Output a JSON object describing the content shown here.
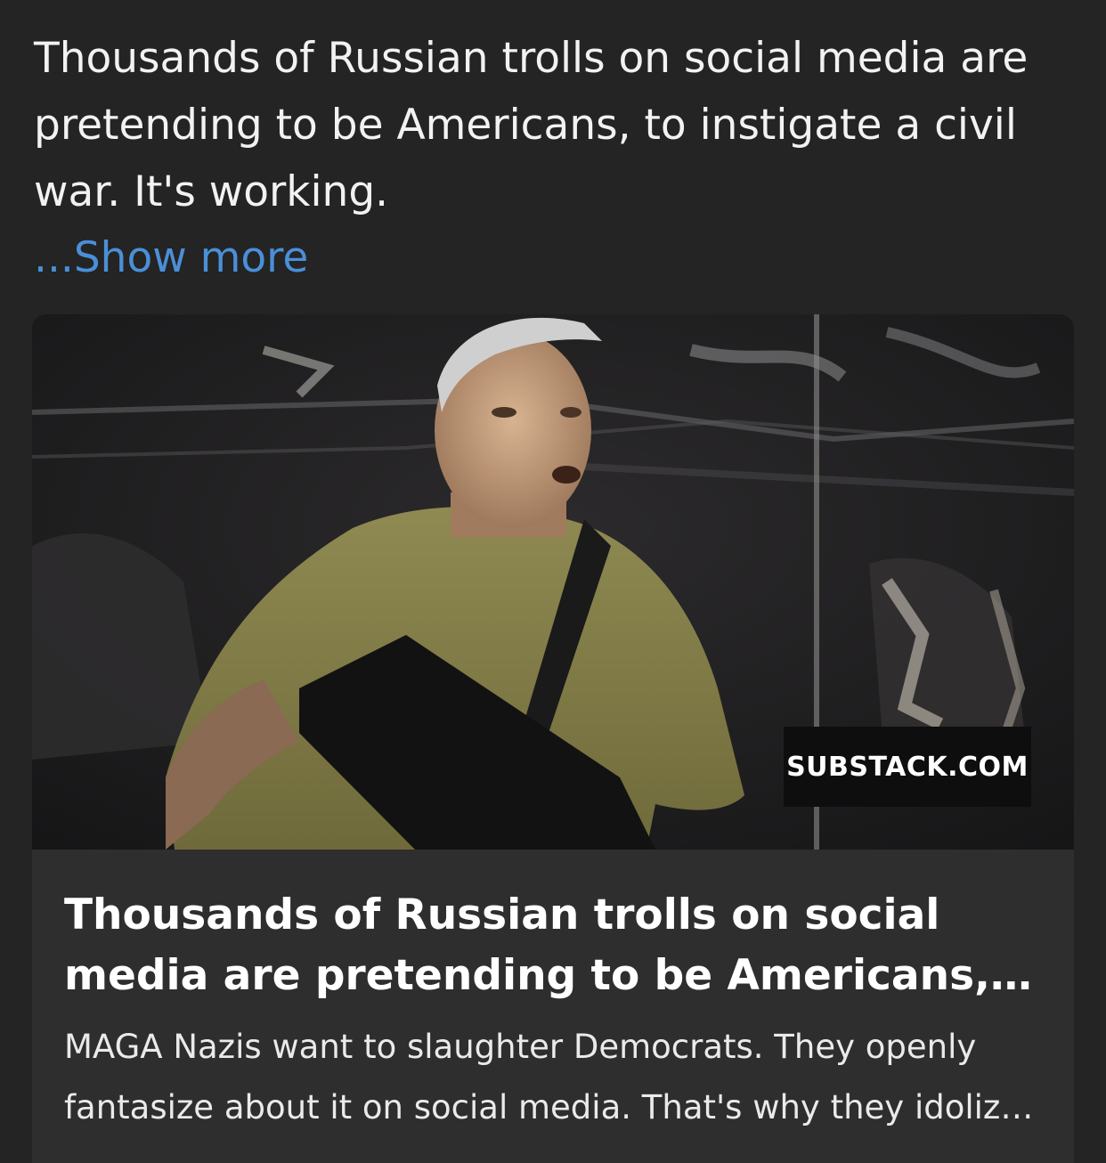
{
  "post": {
    "text": "Thousands of Russian trolls on social media are pretending to be Americans, to instigate a civil war. It's working.",
    "show_more": "...Show more"
  },
  "link_card": {
    "image_icon": "news-photo",
    "domain": "SUBSTACK.COM",
    "title": "Thousands of Russian trolls on social media are pretending to be Americans, to instigate a civil war. It's working.",
    "description": "MAGA Nazis want to slaughter Democrats. They openly fantasize about it on social media. That's why they idolize Kyle Rittenhouse."
  },
  "colors": {
    "background": "#242424",
    "card": "#2e2e2e",
    "link": "#4a8fd8",
    "text": "#f2f2f2"
  }
}
